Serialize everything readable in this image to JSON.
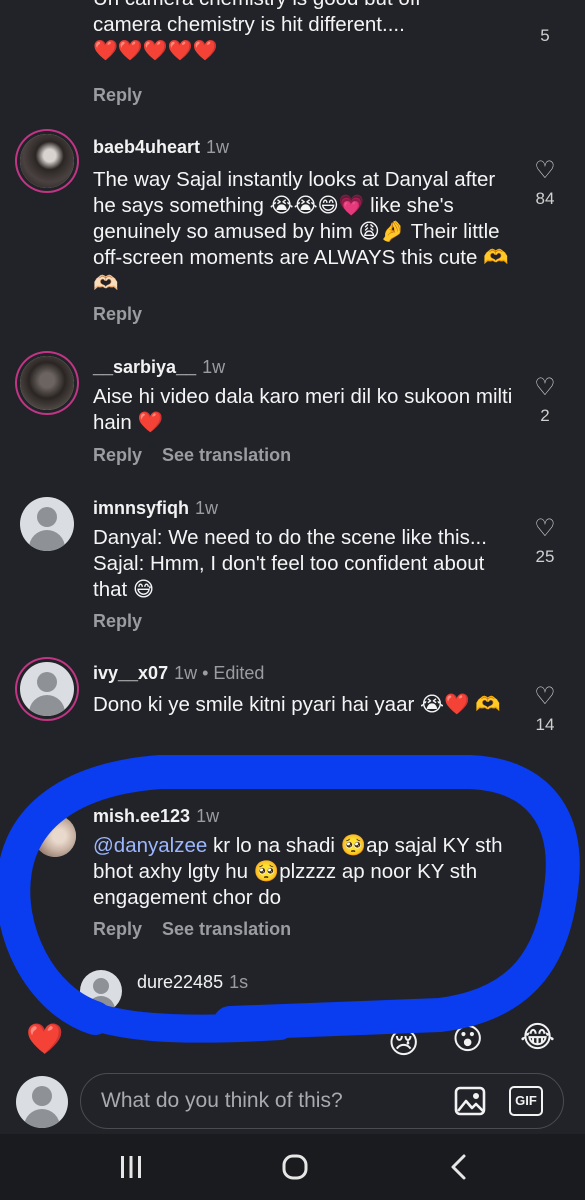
{
  "comments": [
    {
      "text_line1": "Un camera chemistry is good but off",
      "text_line2": "camera chemistry is hit  different....",
      "hearts": "❤️❤️❤️❤️❤️",
      "reply": "Reply",
      "likes": "5"
    },
    {
      "user": "baeb4uheart",
      "time": "1w",
      "text": "The way Sajal instantly looks at Danyal after he says something 😭😭😄💗 like she's genuinely so amused by him 😩🤌 Their little off-screen moments are ALWAYS this cute 🫶🫶🏻",
      "reply": "Reply",
      "likes": "84"
    },
    {
      "user": "__sarbiya__",
      "time": "1w",
      "text": "Aise hi video dala karo meri dil ko sukoon milti hain ❤️",
      "reply": "Reply",
      "translate": "See translation",
      "likes": "2"
    },
    {
      "user": "imnnsyfiqh",
      "time": "1w",
      "text": "Danyal: We need to do the scene like this... Sajal: Hmm, I don't feel too confident about that 😅",
      "reply": "Reply",
      "likes": "25"
    },
    {
      "user": "ivy__x07",
      "time": "1w • Edited",
      "text": "Dono ki ye smile kitni pyari hai yaar 😭❤️ 🫶",
      "reply": "Reply",
      "likes": "14"
    },
    {
      "user": "mish.ee123",
      "time": "1w",
      "mention": "@danyalzee",
      "text": " kr lo na shadi 🥺ap sajal KY sth bhot axhy lgty hu 🥺plzzzz ap noor KY sth engagement chor do",
      "reply": "Reply",
      "translate": "See translation"
    },
    {
      "user": "dure22485",
      "time": "1s"
    }
  ],
  "reactions": [
    "❤️",
    "🙌",
    "🔥",
    "👏",
    "😢",
    "😍",
    "😮",
    "😂"
  ],
  "composer": {
    "placeholder": "What do you think of this?",
    "gif_label": "GIF"
  },
  "colors": {
    "background": "#212328",
    "scribble": "#0a3cf0",
    "mention": "#9db7ff"
  },
  "icons": {
    "like": "heart-outline-icon",
    "image": "image-icon",
    "nav_recents": "recents-icon",
    "nav_home": "home-icon",
    "nav_back": "back-icon"
  }
}
